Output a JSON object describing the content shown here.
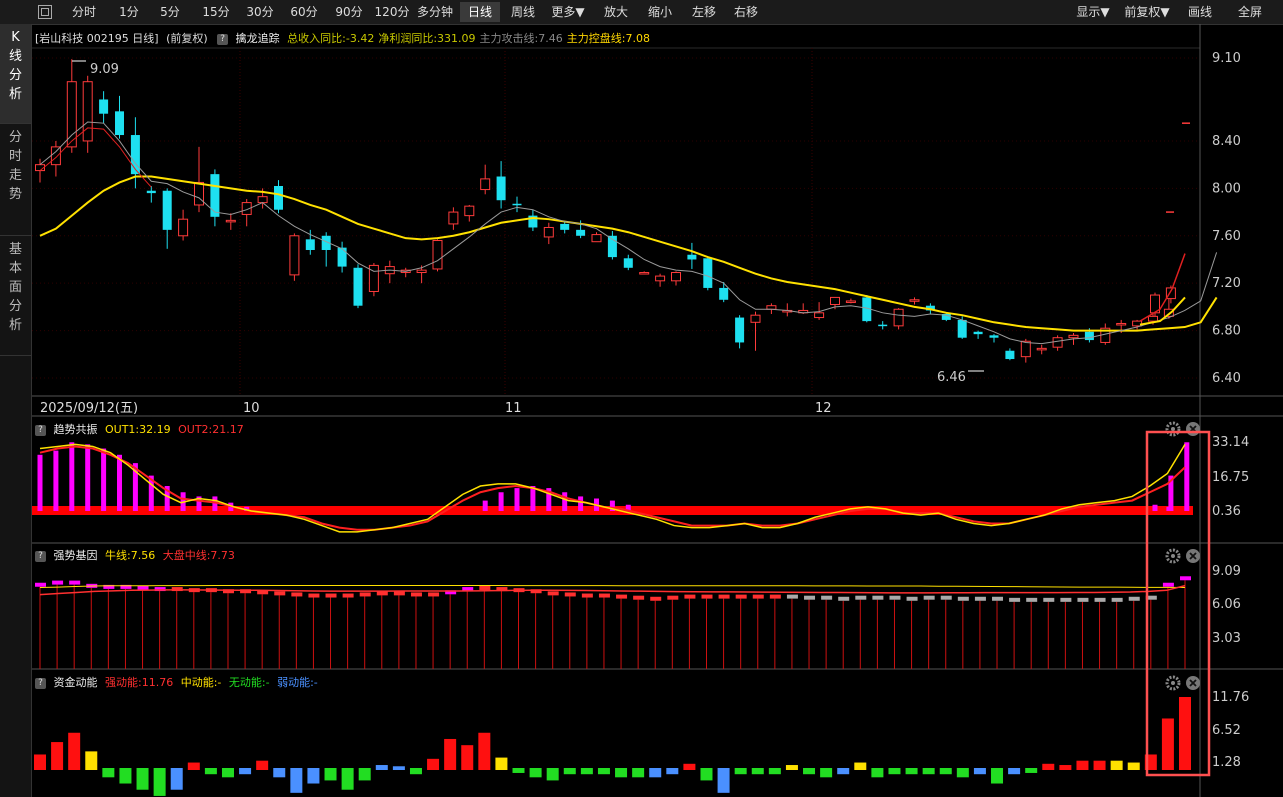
{
  "toolbar": {
    "periods": [
      "分时",
      "1分",
      "5分",
      "15分",
      "30分",
      "60分",
      "90分",
      "120分",
      "多分钟",
      "日线",
      "周线",
      "更多▼"
    ],
    "active_period": "日线",
    "actions": [
      "放大",
      "缩小",
      "左移",
      "右移"
    ],
    "right": [
      "显示▼",
      "前复权▼",
      "画线",
      "全屏"
    ]
  },
  "sidebar": [
    {
      "label": "K线分析",
      "active": true
    },
    {
      "label": "分时走势",
      "active": false
    },
    {
      "label": "基本面分析",
      "active": false
    }
  ],
  "main_panel": {
    "stock_label": "[岩山科技 002195 日线]",
    "adjust": "(前复权)",
    "indicator": "擒龙追踪",
    "values": [
      {
        "text": "总收入同比:-3.42",
        "color": "#c8c800"
      },
      {
        "text": "净利润同比:331.09",
        "color": "#c8c800"
      },
      {
        "text": "主力攻击线:7.46",
        "color": "#888888"
      },
      {
        "text": "主力控盘线:7.08",
        "color": "#ffd700"
      }
    ],
    "high_label": "9.09",
    "low_label": "6.46",
    "y_ticks": [
      "9.10",
      "8.40",
      "8.00",
      "7.60",
      "7.20",
      "6.80",
      "6.40"
    ],
    "y_tick_values": [
      9.1,
      8.4,
      8.0,
      7.6,
      7.2,
      6.8,
      6.4
    ],
    "date_labels": [
      "2025/09/12(五)",
      "10",
      "11",
      "12"
    ]
  },
  "panel2": {
    "name": "趋势共振",
    "out1": "OUT1:32.19",
    "out2": "OUT2:21.17",
    "y_ticks": [
      "33.14",
      "16.75",
      "0.36"
    ]
  },
  "panel3": {
    "name": "强势基因",
    "line1": "牛线:7.56",
    "line2": "大盘中线:7.73",
    "y_ticks": [
      "9.09",
      "6.06",
      "3.03"
    ]
  },
  "panel4": {
    "name": "资金动能",
    "v1": "强动能:11.76",
    "v2": "中动能:-",
    "v3": "无动能:-",
    "v4": "弱动能:-",
    "y_ticks": [
      "11.76",
      "6.52",
      "1.28"
    ]
  },
  "colors": {
    "up": "#ff3b3b",
    "down": "#1ee0f0",
    "ma_yellow": "#ffe100",
    "ma_red": "#e02020",
    "magenta": "#ff00ff",
    "highlight": "#ff5050"
  },
  "chart_data": {
    "type": "candlestick",
    "ohlc": [
      [
        8.15,
        8.25,
        8.05,
        8.2
      ],
      [
        8.2,
        8.4,
        8.1,
        8.35
      ],
      [
        8.35,
        9.09,
        8.3,
        8.9
      ],
      [
        8.4,
        8.95,
        8.3,
        8.9
      ],
      [
        8.75,
        8.82,
        8.55,
        8.63
      ],
      [
        8.65,
        8.78,
        8.42,
        8.45
      ],
      [
        8.45,
        8.6,
        8.0,
        8.12
      ],
      [
        7.98,
        8.02,
        7.88,
        7.96
      ],
      [
        7.98,
        8.0,
        7.49,
        7.65
      ],
      [
        7.6,
        7.82,
        7.56,
        7.74
      ],
      [
        7.86,
        8.35,
        7.8,
        8.05
      ],
      [
        8.12,
        8.16,
        7.68,
        7.76
      ],
      [
        7.72,
        7.79,
        7.65,
        7.73
      ],
      [
        7.78,
        7.91,
        7.68,
        7.88
      ],
      [
        7.88,
        8.0,
        7.83,
        7.93
      ],
      [
        8.02,
        8.07,
        7.79,
        7.82
      ],
      [
        7.27,
        7.62,
        7.22,
        7.6
      ],
      [
        7.57,
        7.65,
        7.44,
        7.48
      ],
      [
        7.6,
        7.63,
        7.34,
        7.48
      ],
      [
        7.5,
        7.55,
        7.29,
        7.34
      ],
      [
        7.33,
        7.36,
        6.99,
        7.01
      ],
      [
        7.13,
        7.37,
        7.09,
        7.35
      ],
      [
        7.28,
        7.39,
        7.2,
        7.34
      ],
      [
        7.29,
        7.33,
        7.25,
        7.31
      ],
      [
        7.29,
        7.35,
        7.2,
        7.31
      ],
      [
        7.32,
        7.57,
        7.3,
        7.56
      ],
      [
        7.7,
        7.84,
        7.65,
        7.8
      ],
      [
        7.77,
        7.86,
        7.72,
        7.85
      ],
      [
        7.99,
        8.2,
        7.95,
        8.08
      ],
      [
        8.1,
        8.23,
        7.83,
        7.9
      ],
      [
        7.87,
        7.93,
        7.8,
        7.86
      ],
      [
        7.77,
        7.82,
        7.64,
        7.67
      ],
      [
        7.59,
        7.71,
        7.53,
        7.67
      ],
      [
        7.7,
        7.72,
        7.62,
        7.65
      ],
      [
        7.65,
        7.73,
        7.58,
        7.6
      ],
      [
        7.55,
        7.63,
        7.55,
        7.61
      ],
      [
        7.6,
        7.64,
        7.4,
        7.42
      ],
      [
        7.41,
        7.44,
        7.31,
        7.33
      ],
      [
        7.29,
        7.3,
        7.28,
        7.29
      ],
      [
        7.22,
        7.28,
        7.17,
        7.26
      ],
      [
        7.22,
        7.3,
        7.18,
        7.29
      ],
      [
        7.44,
        7.54,
        7.32,
        7.4
      ],
      [
        7.41,
        7.42,
        7.14,
        7.16
      ],
      [
        7.16,
        7.21,
        7.04,
        7.06
      ],
      [
        6.91,
        6.93,
        6.65,
        6.7
      ],
      [
        6.87,
        6.96,
        6.63,
        6.93
      ],
      [
        6.98,
        7.03,
        6.94,
        7.01
      ],
      [
        6.96,
        7.03,
        6.92,
        6.97
      ],
      [
        6.95,
        7.03,
        6.94,
        6.97
      ],
      [
        6.91,
        7.04,
        6.89,
        6.95
      ],
      [
        7.02,
        7.08,
        6.98,
        7.08
      ],
      [
        7.05,
        7.07,
        7.03,
        7.05
      ],
      [
        7.08,
        7.1,
        6.87,
        6.88
      ],
      [
        6.85,
        6.88,
        6.81,
        6.84
      ],
      [
        6.84,
        6.99,
        6.81,
        6.98
      ],
      [
        7.05,
        7.08,
        7.02,
        7.06
      ],
      [
        7.01,
        7.03,
        6.94,
        6.97
      ],
      [
        6.94,
        6.95,
        6.88,
        6.89
      ],
      [
        6.89,
        6.92,
        6.73,
        6.74
      ],
      [
        6.79,
        6.8,
        6.73,
        6.77
      ],
      [
        6.76,
        6.77,
        6.7,
        6.74
      ],
      [
        6.63,
        6.65,
        6.55,
        6.56
      ],
      [
        6.58,
        6.73,
        6.53,
        6.71
      ],
      [
        6.64,
        6.68,
        6.6,
        6.65
      ],
      [
        6.66,
        6.76,
        6.63,
        6.74
      ],
      [
        6.74,
        6.78,
        6.68,
        6.76
      ],
      [
        6.79,
        6.82,
        6.7,
        6.72
      ],
      [
        6.7,
        6.86,
        6.68,
        6.82
      ],
      [
        6.85,
        6.89,
        6.78,
        6.86
      ],
      [
        6.84,
        6.89,
        6.81,
        6.88
      ],
      [
        6.88,
        7.03,
        6.85,
        6.92
      ],
      [
        6.92,
        7.08,
        6.9,
        6.98
      ],
      [
        6.95,
        7.12,
        6.92,
        7.1
      ],
      [
        7.07,
        7.18,
        7.03,
        7.16
      ],
      [
        6.9,
        6.91,
        6.89,
        6.9
      ],
      [
        7.54,
        7.56,
        7.52,
        7.54
      ],
      [
        8.45,
        8.46,
        8.44,
        8.45
      ]
    ],
    "ma_short": [
      8.2,
      8.31,
      8.45,
      8.56,
      8.55,
      8.4,
      8.21,
      8.06,
      8.04,
      7.97,
      7.92,
      7.8,
      7.78,
      7.82,
      7.88,
      7.77,
      7.68,
      7.61,
      7.55,
      7.49,
      7.37,
      7.3,
      7.31,
      7.3,
      7.33,
      7.39,
      7.49,
      7.59,
      7.7,
      7.8,
      7.84,
      7.82,
      7.76,
      7.72,
      7.7,
      7.66,
      7.57,
      7.49,
      7.4,
      7.34,
      7.31,
      7.3,
      7.26,
      7.2,
      7.06,
      6.98,
      6.98,
      6.97,
      6.95,
      6.96,
      7.0,
      7.01,
      6.99,
      6.95,
      6.93,
      6.92,
      6.94,
      6.93,
      6.89,
      6.84,
      6.79,
      6.73,
      6.7,
      6.69,
      6.71,
      6.73,
      6.74,
      6.77,
      6.8,
      6.83,
      6.87,
      6.91,
      6.97,
      7.05,
      7.46
    ],
    "ma_long": [
      7.6,
      7.66,
      7.77,
      7.88,
      7.98,
      8.05,
      8.1,
      8.1,
      8.08,
      8.06,
      8.04,
      8.02,
      8.0,
      7.98,
      7.97,
      7.95,
      7.91,
      7.86,
      7.82,
      7.76,
      7.7,
      7.66,
      7.62,
      7.58,
      7.57,
      7.58,
      7.6,
      7.63,
      7.67,
      7.71,
      7.73,
      7.75,
      7.74,
      7.72,
      7.7,
      7.68,
      7.66,
      7.63,
      7.59,
      7.55,
      7.51,
      7.47,
      7.42,
      7.38,
      7.33,
      7.28,
      7.24,
      7.21,
      7.19,
      7.17,
      7.15,
      7.12,
      7.09,
      7.06,
      7.03,
      7.0,
      6.98,
      6.95,
      6.93,
      6.9,
      6.87,
      6.85,
      6.83,
      6.82,
      6.81,
      6.8,
      6.8,
      6.8,
      6.8,
      6.8,
      6.81,
      6.82,
      6.83,
      6.87,
      7.08
    ],
    "trend_bars": [
      27,
      29,
      33,
      32,
      30,
      27,
      23,
      17,
      12,
      9,
      7,
      7,
      4,
      2,
      1,
      1,
      1,
      1,
      1,
      1,
      1,
      1,
      1,
      1,
      1,
      1,
      1,
      1,
      5,
      9,
      11,
      12,
      11,
      9,
      7,
      6,
      5,
      3,
      1,
      1,
      1,
      1,
      1,
      1,
      1,
      1,
      1,
      1,
      1,
      1,
      1,
      1,
      1,
      1,
      1,
      1,
      1,
      1,
      1,
      1,
      1,
      1,
      1,
      1,
      1,
      1,
      1,
      1,
      1,
      1,
      1,
      2,
      3,
      17,
      33
    ],
    "out1": [
      30,
      31,
      32,
      31,
      28,
      22,
      15,
      8,
      4,
      6,
      5,
      2,
      0,
      -1,
      -2,
      -4,
      -7,
      -10,
      -10,
      -9,
      -8,
      -6,
      -4,
      2,
      8,
      12,
      13,
      13,
      11,
      8,
      5,
      4,
      2,
      0,
      -2,
      -4,
      -7,
      -8,
      -8,
      -7,
      -6,
      -8,
      -8,
      -6,
      -3,
      -1,
      1,
      2,
      1,
      -1,
      -2,
      -1,
      -4,
      -6,
      -7,
      -6,
      -4,
      -2,
      1,
      3,
      4,
      5,
      7,
      12,
      18,
      32
    ],
    "out2": [
      28,
      30,
      31,
      30,
      27,
      23,
      17,
      11,
      6,
      5,
      4,
      2,
      0,
      -1,
      -2,
      -3,
      -6,
      -8,
      -9,
      -9,
      -8,
      -7,
      -5,
      0,
      5,
      9,
      11,
      12,
      11,
      9,
      6,
      4,
      2,
      1,
      -1,
      -3,
      -5,
      -7,
      -7,
      -7,
      -6,
      -7,
      -7,
      -6,
      -4,
      -2,
      0,
      1,
      1,
      -1,
      -1,
      -1,
      -3,
      -5,
      -6,
      -6,
      -4,
      -2,
      0,
      2,
      3,
      4,
      5,
      9,
      13,
      21
    ],
    "gene_bars": [
      8.0,
      8.2,
      8.2,
      7.9,
      7.8,
      7.8,
      7.7,
      7.6,
      7.6,
      7.5,
      7.5,
      7.4,
      7.4,
      7.3,
      7.2,
      7.1,
      7.0,
      7.0,
      7.0,
      7.1,
      7.2,
      7.2,
      7.1,
      7.1,
      7.3,
      7.6,
      7.7,
      7.6,
      7.5,
      7.4,
      7.2,
      7.1,
      7.0,
      7.0,
      6.9,
      6.8,
      6.7,
      6.8,
      6.9,
      6.9,
      6.9,
      6.9,
      6.9,
      6.9,
      6.9,
      6.8,
      6.8,
      6.7,
      6.8,
      6.8,
      6.8,
      6.7,
      6.8,
      6.8,
      6.7,
      6.7,
      6.7,
      6.6,
      6.6,
      6.6,
      6.6,
      6.6,
      6.6,
      6.6,
      6.7,
      6.8,
      8.0,
      8.6
    ],
    "gene_line_yellow": [
      7.56,
      7.6,
      7.65,
      7.7,
      7.72,
      7.72,
      7.72,
      7.73,
      7.73,
      7.73,
      7.74,
      7.74,
      7.74,
      7.74,
      7.74,
      7.74,
      7.74,
      7.74,
      7.74,
      7.74,
      7.74,
      7.74,
      7.74,
      7.74,
      7.74,
      7.74,
      7.74,
      7.73,
      7.73,
      7.73,
      7.73,
      7.73,
      7.73,
      7.72,
      7.72,
      7.72,
      7.72,
      7.72,
      7.72,
      7.72,
      7.72,
      7.72,
      7.72,
      7.72,
      7.71,
      7.71,
      7.71,
      7.7,
      7.7,
      7.7,
      7.7,
      7.68,
      7.67,
      7.66,
      7.65,
      7.64,
      7.63,
      7.62,
      7.61,
      7.6,
      7.6,
      7.59,
      7.58,
      7.57,
      7.57,
      7.56
    ],
    "gene_line_red": [
      6.9,
      7.0,
      7.1,
      7.2,
      7.25,
      7.3,
      7.32,
      7.34,
      7.34,
      7.33,
      7.32,
      7.3,
      7.3,
      7.28,
      7.26,
      7.24,
      7.22,
      7.22,
      7.22,
      7.22,
      7.23,
      7.24,
      7.24,
      7.24,
      7.25,
      7.27,
      7.29,
      7.3,
      7.3,
      7.29,
      7.28,
      7.26,
      7.24,
      7.22,
      7.2,
      7.18,
      7.16,
      7.15,
      7.15,
      7.14,
      7.13,
      7.12,
      7.11,
      7.1,
      7.09,
      7.08,
      7.07,
      7.06,
      7.06,
      7.06,
      7.07,
      7.07,
      7.08,
      7.08,
      7.08,
      7.08,
      7.08,
      7.09,
      7.1,
      7.12,
      7.14,
      7.2,
      7.3,
      7.73
    ],
    "fund_bars": [
      2.5,
      4.5,
      6.0,
      3.0,
      -1.5,
      -2.5,
      -3.5,
      -4.5,
      -3.5,
      1.2,
      -1.0,
      -1.5,
      -1.0,
      1.5,
      -1.5,
      -4.0,
      -2.5,
      -2.0,
      -3.5,
      -2.0,
      0.8,
      0.6,
      -1.0,
      1.8,
      5.0,
      4.0,
      6.0,
      2.0,
      -0.8,
      -1.5,
      -2.0,
      -1.0,
      -1.0,
      -1.0,
      -1.5,
      -1.5,
      -1.5,
      -1.0,
      1.0,
      -2.0,
      -4.0,
      -1.0,
      -1.0,
      -1.0,
      0.8,
      -1.0,
      -1.5,
      -1.0,
      1.2,
      -1.5,
      -1.0,
      -1.0,
      -1.0,
      -1.0,
      -1.5,
      -1.0,
      -2.5,
      -1.0,
      -0.8,
      1.0,
      0.8,
      1.5,
      1.5,
      1.5,
      1.2,
      2.5,
      8.3,
      11.76
    ],
    "fund_colors": [
      "r",
      "r",
      "r",
      "y",
      "g",
      "g",
      "g",
      "g",
      "b",
      "r",
      "g",
      "g",
      "b",
      "r",
      "b",
      "b",
      "b",
      "g",
      "g",
      "g",
      "b",
      "b",
      "g",
      "r",
      "r",
      "r",
      "r",
      "y",
      "g",
      "g",
      "g",
      "g",
      "g",
      "g",
      "g",
      "g",
      "b",
      "b",
      "r",
      "g",
      "b",
      "g",
      "g",
      "g",
      "y",
      "g",
      "g",
      "b",
      "y",
      "g",
      "g",
      "g",
      "g",
      "g",
      "g",
      "b",
      "g",
      "b",
      "g",
      "r",
      "r",
      "r",
      "r",
      "y",
      "y",
      "r",
      "r",
      "r"
    ]
  }
}
